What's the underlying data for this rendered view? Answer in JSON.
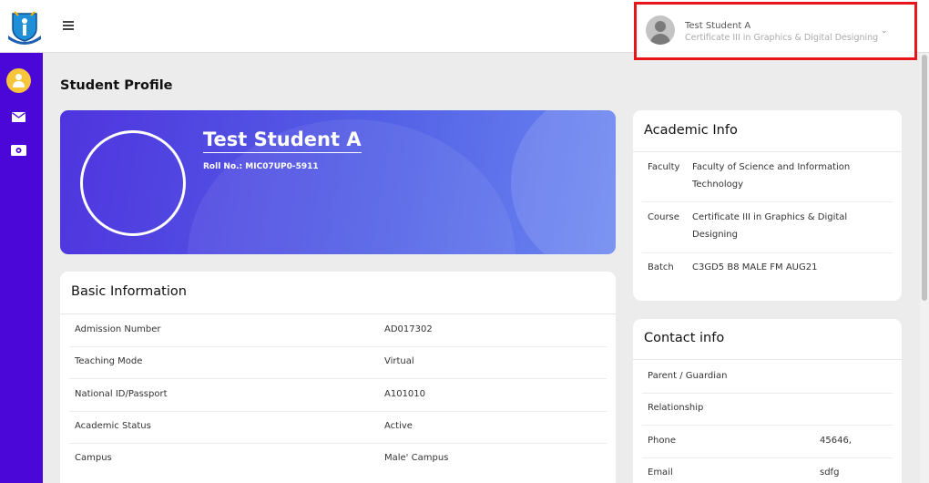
{
  "user": {
    "name": "Test Student A",
    "course": "Certificate III in Graphics & Digital Designing"
  },
  "page": {
    "title": "Student Profile"
  },
  "profile": {
    "name": "Test Student A",
    "roll": "Roll No.: MIC07UP0-5911"
  },
  "basic": {
    "title": "Basic Information",
    "rows": [
      {
        "label": "Admission Number",
        "value": "AD017302"
      },
      {
        "label": "Teaching Mode",
        "value": "Virtual"
      },
      {
        "label": "National ID/Passport",
        "value": "A101010"
      },
      {
        "label": "Academic Status",
        "value": "Active"
      },
      {
        "label": "Campus",
        "value": "Male' Campus"
      }
    ]
  },
  "academic": {
    "title": "Academic Info",
    "rows": [
      {
        "label": "Faculty",
        "value": "Faculty of Science and Information Technology"
      },
      {
        "label": "Course",
        "value": "Certificate III in Graphics & Digital Designing"
      },
      {
        "label": "Batch",
        "value": "C3GD5 B8 MALE FM AUG21"
      }
    ]
  },
  "contact": {
    "title": "Contact info",
    "rows": [
      {
        "label": "Parent / Guardian",
        "value": ""
      },
      {
        "label": "Relationship",
        "value": ""
      },
      {
        "label": "Phone",
        "value": "45646,"
      },
      {
        "label": "Email",
        "value": "sdfg"
      }
    ]
  },
  "colors": {
    "sidebar": "#4a07d8",
    "highlight": "#e8151b",
    "avatar_badge": "#f6c53c"
  }
}
